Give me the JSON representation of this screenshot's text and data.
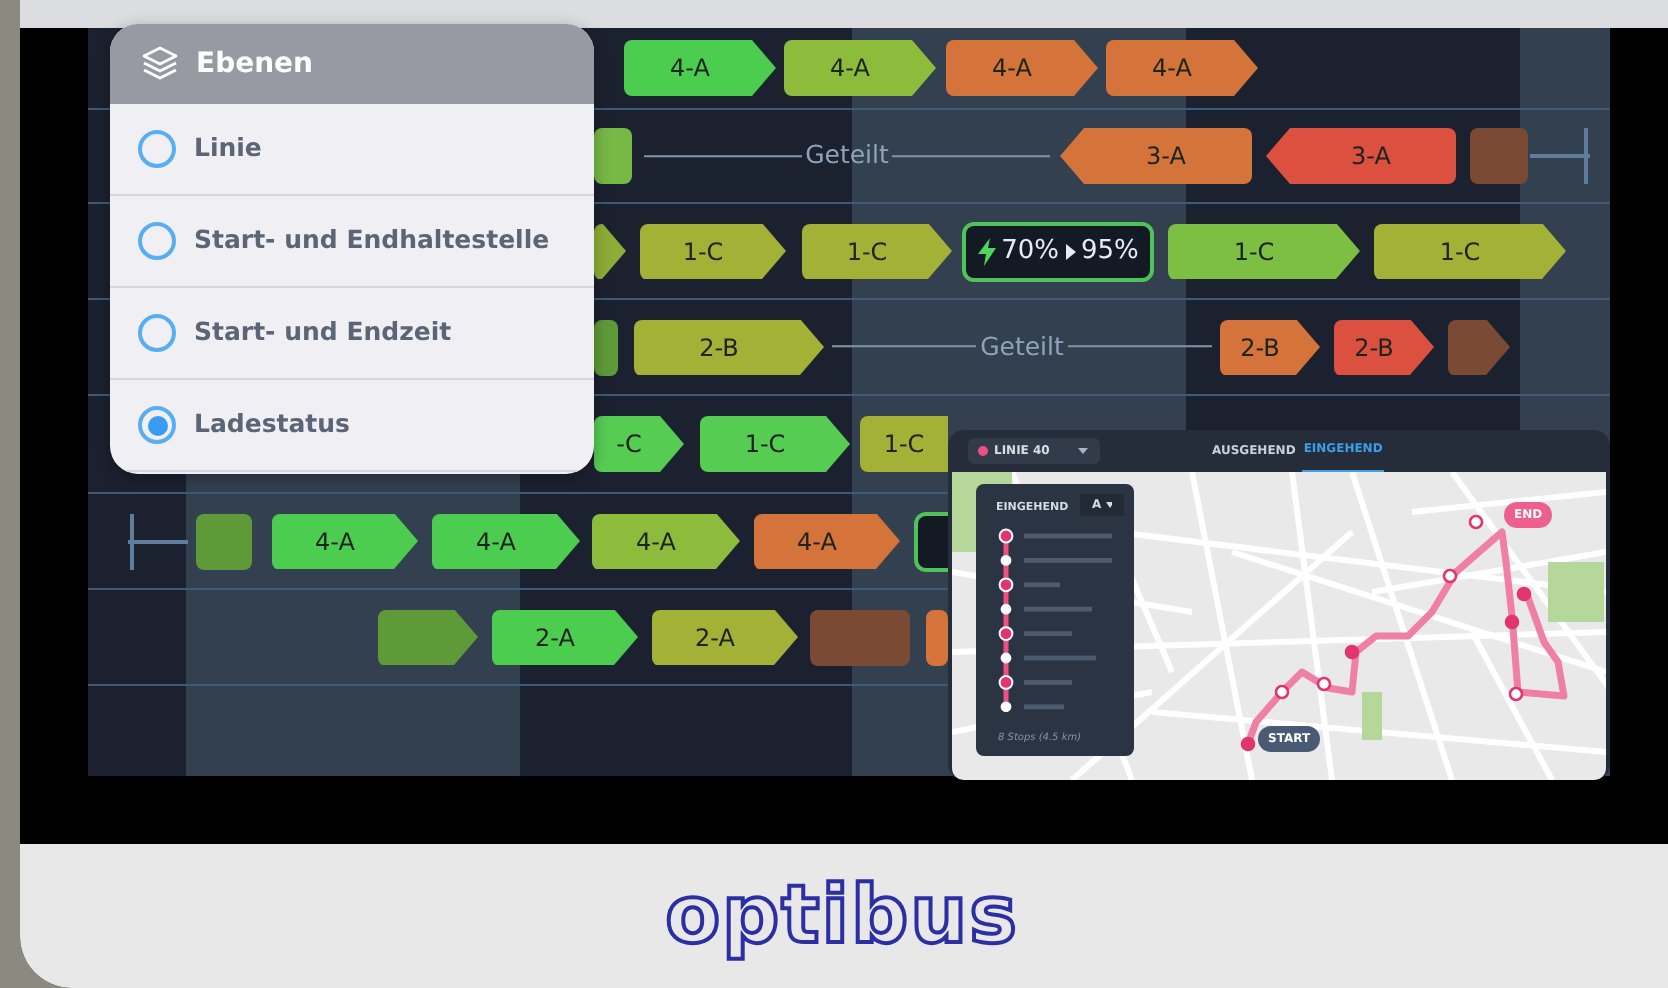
{
  "layers_panel": {
    "title": "Ebenen",
    "options": [
      {
        "label": "Linie",
        "selected": false
      },
      {
        "label": "Start- und Endhaltestelle",
        "selected": false
      },
      {
        "label": "Start- und Endzeit",
        "selected": false
      },
      {
        "label": "Ladestatus",
        "selected": true
      }
    ]
  },
  "schedule": {
    "rows": [
      {
        "items": [
          {
            "kind": "arrow",
            "label": "4-A",
            "color": "#4ccd50"
          },
          {
            "kind": "arrow",
            "label": "4-A",
            "color": "#8dbb3c"
          },
          {
            "kind": "arrow",
            "label": "4-A",
            "color": "#d4733a"
          },
          {
            "kind": "arrow",
            "label": "4-A",
            "color": "#d4733a"
          }
        ]
      },
      {
        "items": [
          {
            "kind": "square",
            "color": "#78b845"
          },
          {
            "kind": "split",
            "label": "Geteilt"
          },
          {
            "kind": "arrow-left",
            "label": "3-A",
            "color": "#d4733a"
          },
          {
            "kind": "arrow-left",
            "label": "3-A",
            "color": "#dc5040"
          },
          {
            "kind": "square",
            "color": "#7a4a35"
          },
          {
            "kind": "end-cap"
          }
        ]
      },
      {
        "items": [
          {
            "kind": "arrow",
            "color": "#8cae36"
          },
          {
            "kind": "arrow",
            "label": "1-C",
            "color": "#a3b136"
          },
          {
            "kind": "arrow",
            "label": "1-C",
            "color": "#a3b136"
          },
          {
            "kind": "charge",
            "from": "70%",
            "to": "95%"
          },
          {
            "kind": "arrow",
            "label": "1-C",
            "color": "#7cbf42"
          },
          {
            "kind": "arrow",
            "label": "1-C",
            "color": "#a3b136"
          }
        ]
      },
      {
        "items": [
          {
            "kind": "square",
            "color": "#5f9a38"
          },
          {
            "kind": "arrow",
            "label": "2-B",
            "color": "#a3b136"
          },
          {
            "kind": "split",
            "label": "Geteilt"
          },
          {
            "kind": "arrow",
            "label": "2-B",
            "color": "#d4733a"
          },
          {
            "kind": "arrow",
            "label": "2-B",
            "color": "#dc5040"
          },
          {
            "kind": "arrow",
            "color": "#7a4a35"
          }
        ]
      },
      {
        "items": [
          {
            "kind": "arrow",
            "label": "-C",
            "color": "#57cc53"
          },
          {
            "kind": "arrow",
            "label": "1-C",
            "color": "#57cc53"
          },
          {
            "kind": "arrow",
            "label": "1-C",
            "color": "#a3b136"
          }
        ]
      },
      {
        "items": [
          {
            "kind": "end-cap"
          },
          {
            "kind": "square",
            "color": "#5f9a38"
          },
          {
            "kind": "arrow",
            "label": "4-A",
            "color": "#4ccd50"
          },
          {
            "kind": "arrow",
            "label": "4-A",
            "color": "#4ccd50"
          },
          {
            "kind": "arrow",
            "label": "4-A",
            "color": "#8dbb3c"
          },
          {
            "kind": "arrow",
            "label": "4-A",
            "color": "#d4733a"
          },
          {
            "kind": "charge"
          }
        ]
      },
      {
        "items": [
          {
            "kind": "arrow",
            "color": "#5f9a38"
          },
          {
            "kind": "arrow",
            "label": "2-A",
            "color": "#4ccd50"
          },
          {
            "kind": "arrow",
            "label": "2-A",
            "color": "#a3b136"
          },
          {
            "kind": "square",
            "color": "#7a4a35"
          },
          {
            "kind": "square",
            "color": "#d4733a"
          }
        ]
      },
      {
        "items": []
      }
    ]
  },
  "route_map": {
    "line_selector": "LINIE 40",
    "direction_tabs": [
      {
        "label": "AUSGEHEND",
        "selected": false
      },
      {
        "label": "EINGEHEND",
        "selected": true
      }
    ],
    "stop_list": {
      "title": "EINGEHEND",
      "variant": "A",
      "summary": "8 Stops (4.5 km)"
    },
    "start_label": "START",
    "end_label": "END"
  },
  "brand": "optibus"
}
